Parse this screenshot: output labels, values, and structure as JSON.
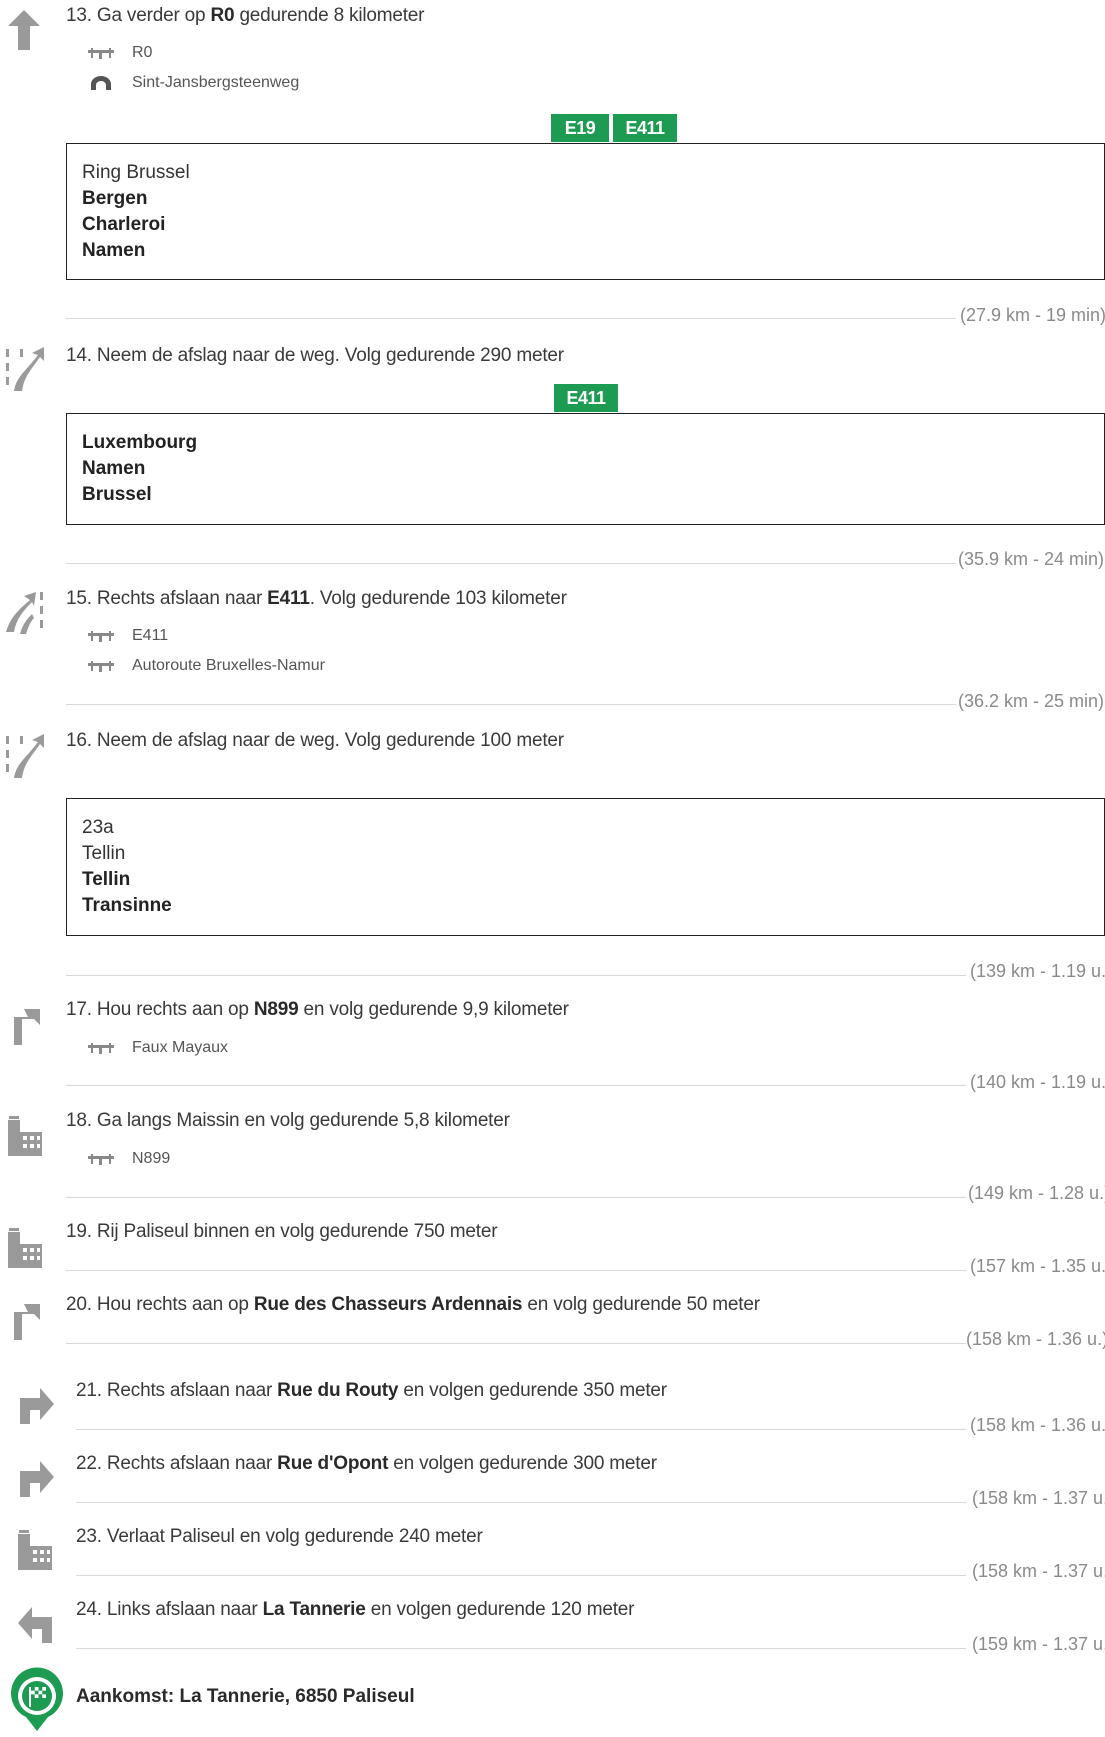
{
  "steps": [
    {
      "id": "13",
      "text_parts": [
        "13. Ga verder op ",
        "R0",
        " gedurende 8 kilometer"
      ],
      "details": [
        {
          "icon": "road-icon",
          "text": "R0"
        },
        {
          "icon": "tunnel-icon",
          "text": "Sint-Jansbergsteenweg"
        }
      ],
      "shields": [
        "E19",
        "E411"
      ],
      "sign": [
        {
          "text": "Ring Brussel",
          "bold": false
        },
        {
          "text": "Bergen",
          "bold": true
        },
        {
          "text": "Charleroi",
          "bold": true
        },
        {
          "text": "Namen",
          "bold": true
        }
      ],
      "distance": "(27.9 km - 19 min)"
    },
    {
      "id": "14",
      "text_parts": [
        "14. Neem de afslag naar de weg. Volg gedurende 290 meter"
      ],
      "shields": [
        "E411"
      ],
      "sign": [
        {
          "text": "Luxembourg",
          "bold": true
        },
        {
          "text": "Namen",
          "bold": true
        },
        {
          "text": "Brussel",
          "bold": true
        }
      ],
      "distance": "(35.9 km - 24 min)"
    },
    {
      "id": "15",
      "text_parts": [
        "15. Rechts afslaan naar ",
        "E411",
        ". Volg gedurende 103 kilometer"
      ],
      "details": [
        {
          "icon": "road-icon",
          "text": "E411"
        },
        {
          "icon": "road-icon",
          "text": "Autoroute Bruxelles-Namur"
        }
      ],
      "distance": "(36.2 km - 25 min)"
    },
    {
      "id": "16",
      "text_parts": [
        "16. Neem de afslag naar de weg. Volg gedurende 100 meter"
      ],
      "sign": [
        {
          "text": "23a",
          "bold": false
        },
        {
          "text": "Tellin",
          "bold": false
        },
        {
          "text": "Tellin",
          "bold": true
        },
        {
          "text": "Transinne",
          "bold": true
        }
      ],
      "distance": "(139 km - 1.19 u.)"
    },
    {
      "id": "17",
      "text_parts": [
        "17. Hou rechts aan op ",
        "N899",
        " en volg gedurende 9,9 kilometer"
      ],
      "details": [
        {
          "icon": "road-icon",
          "text": "Faux Mayaux"
        }
      ],
      "distance": "(140 km - 1.19 u.)"
    },
    {
      "id": "18",
      "text_parts": [
        "18. Ga langs Maissin en volg gedurende 5,8 kilometer"
      ],
      "details": [
        {
          "icon": "road-icon",
          "text": "N899"
        }
      ],
      "distance": "(149 km - 1.28 u.)"
    },
    {
      "id": "19",
      "text_parts": [
        "19. Rij Paliseul binnen en volg gedurende 750 meter"
      ],
      "distance": "(157 km - 1.35 u.)"
    },
    {
      "id": "20",
      "text_parts": [
        "20. Hou rechts aan op ",
        "Rue des Chasseurs Ardennais",
        " en volg gedurende 50 meter"
      ],
      "distance": "(158 km - 1.36 u.)"
    },
    {
      "id": "21",
      "text_parts": [
        "21. Rechts afslaan naar ",
        "Rue du Routy",
        " en volgen gedurende 350 meter"
      ],
      "distance": "(158 km - 1.36 u.)"
    },
    {
      "id": "22",
      "text_parts": [
        "22. Rechts afslaan naar ",
        "Rue d'Opont",
        " en volgen gedurende 300 meter"
      ],
      "distance": "(158 km - 1.37 u.)"
    },
    {
      "id": "23",
      "text_parts": [
        "23. Verlaat Paliseul en volg gedurende 240 meter"
      ],
      "distance": "(158 km - 1.37 u.)"
    },
    {
      "id": "24",
      "text_parts": [
        "24. Links afslaan naar ",
        "La Tannerie",
        " en volgen gedurende 120 meter"
      ],
      "distance": "(159 km - 1.37 u.)"
    }
  ],
  "arrival": {
    "text": "Aankomst: La Tannerie, 6850 Paliseul",
    "icon": "finish-flag-icon"
  },
  "colors": {
    "shield": "#1e9b52",
    "arrival_badge": "#1e9b52",
    "maneuver_icon": "#9a9a9a"
  }
}
